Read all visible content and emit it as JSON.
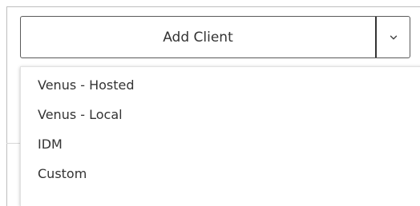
{
  "add_client": {
    "label": "Add Client",
    "toggle_icon": "chevron-down-icon"
  },
  "menu": {
    "items": [
      {
        "label": "Venus - Hosted"
      },
      {
        "label": "Venus - Local"
      },
      {
        "label": "IDM"
      },
      {
        "label": "Custom"
      }
    ]
  }
}
